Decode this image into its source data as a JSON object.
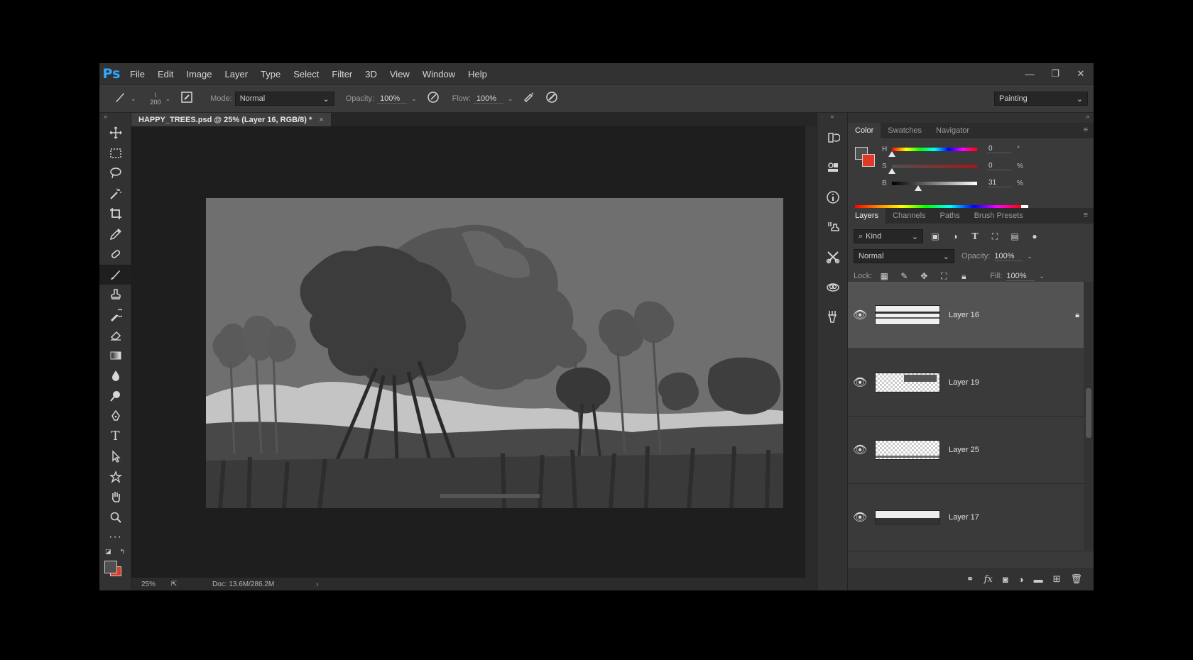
{
  "app": {
    "logo": "Ps"
  },
  "menu": [
    "File",
    "Edit",
    "Image",
    "Layer",
    "Type",
    "Select",
    "Filter",
    "3D",
    "View",
    "Window",
    "Help"
  ],
  "options": {
    "brush_size": "200",
    "mode_label": "Mode:",
    "mode_value": "Normal",
    "opacity_label": "Opacity:",
    "opacity_value": "100%",
    "flow_label": "Flow:",
    "flow_value": "100%",
    "workspace": "Painting"
  },
  "document": {
    "tab_title": "HAPPY_TREES.psd @ 25% (Layer 16, RGB/8) *",
    "zoom": "25%",
    "doc_info": "Doc: 13.6M/286.2M"
  },
  "color_panel": {
    "tabs": [
      "Color",
      "Swatches",
      "Navigator"
    ],
    "h_label": "H",
    "s_label": "S",
    "b_label": "B",
    "h_value": "0",
    "s_value": "0",
    "b_value": "31",
    "h_unit": "°",
    "s_unit": "%",
    "b_unit": "%",
    "h_level": 0,
    "s_level": 0,
    "b_level": 0.31,
    "fg_color": "#4f4f4f",
    "bg_color": "#e03a24"
  },
  "layers_panel": {
    "tabs": [
      "Layers",
      "Channels",
      "Paths",
      "Brush Presets"
    ],
    "filter": "Kind",
    "blend": "Normal",
    "opacity_label": "Opacity:",
    "opacity_value": "100%",
    "lock_label": "Lock:",
    "fill_label": "Fill:",
    "fill_value": "100%",
    "layers": [
      {
        "name": "Layer 16",
        "selected": true,
        "locked": true
      },
      {
        "name": "Layer 19",
        "selected": false
      },
      {
        "name": "Layer 25",
        "selected": false
      },
      {
        "name": "Layer 17",
        "selected": false
      }
    ]
  }
}
